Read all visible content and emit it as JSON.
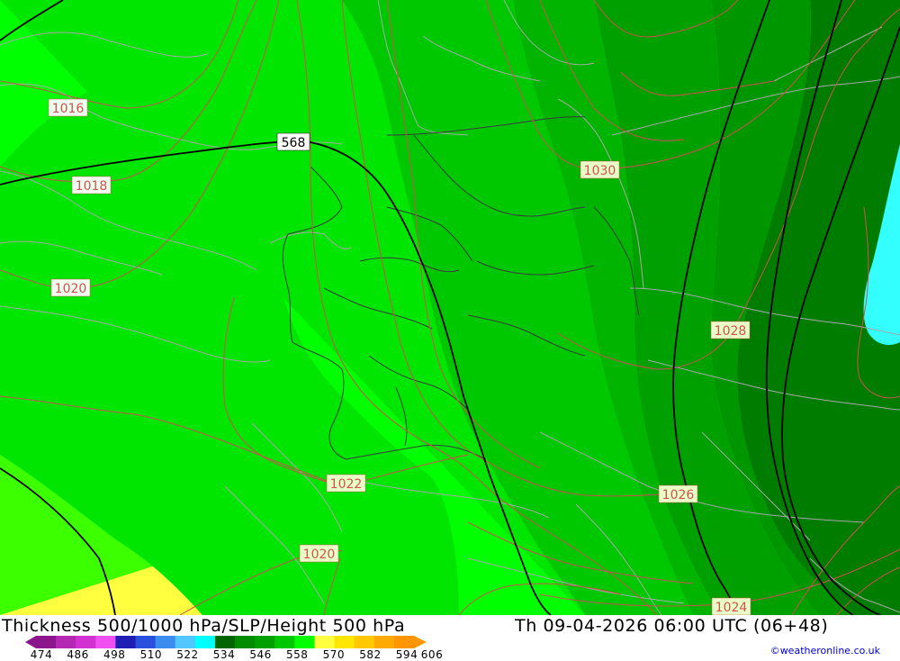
{
  "map": {
    "slp_labels": [
      "1016",
      "1018",
      "1020",
      "1030",
      "1028",
      "1022",
      "1026",
      "1020",
      "1024"
    ],
    "height_label": "568",
    "colors": {
      "band_534": "#008c00",
      "band_540": "#00a000",
      "band_546": "#00b400",
      "band_552": "#00c800",
      "band_558": "#00e100",
      "band_564": "#00ff00",
      "band_570": "#6aff00",
      "band_576": "#ffff40",
      "band_522": "#00ffff",
      "isobar": "#d05050",
      "border": "#a0a0a0",
      "height_contour": "#000000"
    }
  },
  "footer": {
    "title": "Thickness 500/1000 hPa/SLP/Height 500 hPa",
    "datetime": "Th 09-04-2026 06:00 UTC (06+48)",
    "credit": "©weatheronline.co.uk",
    "scale_ticks": [
      "474",
      "486",
      "498",
      "510",
      "522",
      "534",
      "546",
      "558",
      "570",
      "582",
      "594",
      "606"
    ],
    "scale_colors": [
      "#8c148c",
      "#b428b4",
      "#d232d2",
      "#f050f0",
      "#1e1eb4",
      "#2850dc",
      "#3c8cf0",
      "#50c8ff",
      "#00ffff",
      "#006400",
      "#008c00",
      "#00a000",
      "#00c800",
      "#00ff00",
      "#ffff40",
      "#ffe600",
      "#ffc800",
      "#ffaa00",
      "#ff9600"
    ]
  }
}
